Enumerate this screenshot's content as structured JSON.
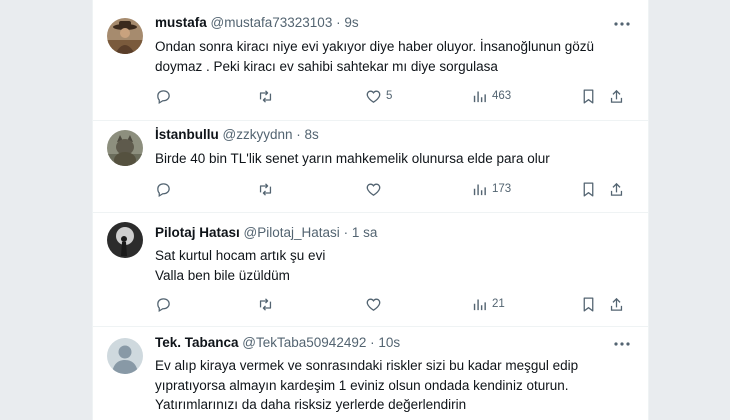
{
  "tweets": [
    {
      "name": "mustafa",
      "handle": "@mustafa73323103",
      "separator": "·",
      "time": "9s",
      "lines": [
        "Ondan sonra kiracı niye evi yakıyor diye haber oluyor. İnsanoğlunun gözü",
        "doymaz . Peki kiracı ev sahibi sahtekar mı diye sorgulasa"
      ],
      "likes": "5",
      "views": "463",
      "avatar": "cowboy-photo"
    },
    {
      "name": "İstanbullu",
      "handle": "@zzkyydnn",
      "separator": "·",
      "time": "8s",
      "lines": [
        "Birde 40 bin TL'lik senet yarın mahkemelik olunursa elde para olur"
      ],
      "likes": "",
      "views": "173",
      "avatar": "cat-photo"
    },
    {
      "name": "Pilotaj Hatası",
      "handle": "@Pilotaj_Hatasi",
      "separator": "·",
      "time": "1 sa",
      "lines": [
        "Sat kurtul hocam artık şu evi",
        "Valla ben bile üzüldüm"
      ],
      "likes": "",
      "views": "21",
      "avatar": "silhouette-photo"
    },
    {
      "name": "Tek. Tabanca",
      "handle": "@TekTaba50942492",
      "separator": "·",
      "time": "10s",
      "lines": [
        "Ev alıp kiraya vermek ve sonrasındaki riskler sizi bu kadar meşgul edip",
        "yıpratıyorsa almayın kardeşim 1 eviniz olsun ondada kendiniz oturun.",
        "Yatırımlarınızı da daha risksiz yerlerde değerlendirin"
      ],
      "likes": "",
      "views": "",
      "avatar": "default-avatar"
    }
  ],
  "colors": {
    "text": "#0f1419",
    "secondary": "#536471",
    "divider": "#eff3f4"
  },
  "icons": [
    "more-icon",
    "reply-icon",
    "retweet-icon",
    "like-icon",
    "views-icon",
    "bookmark-icon",
    "share-icon"
  ]
}
